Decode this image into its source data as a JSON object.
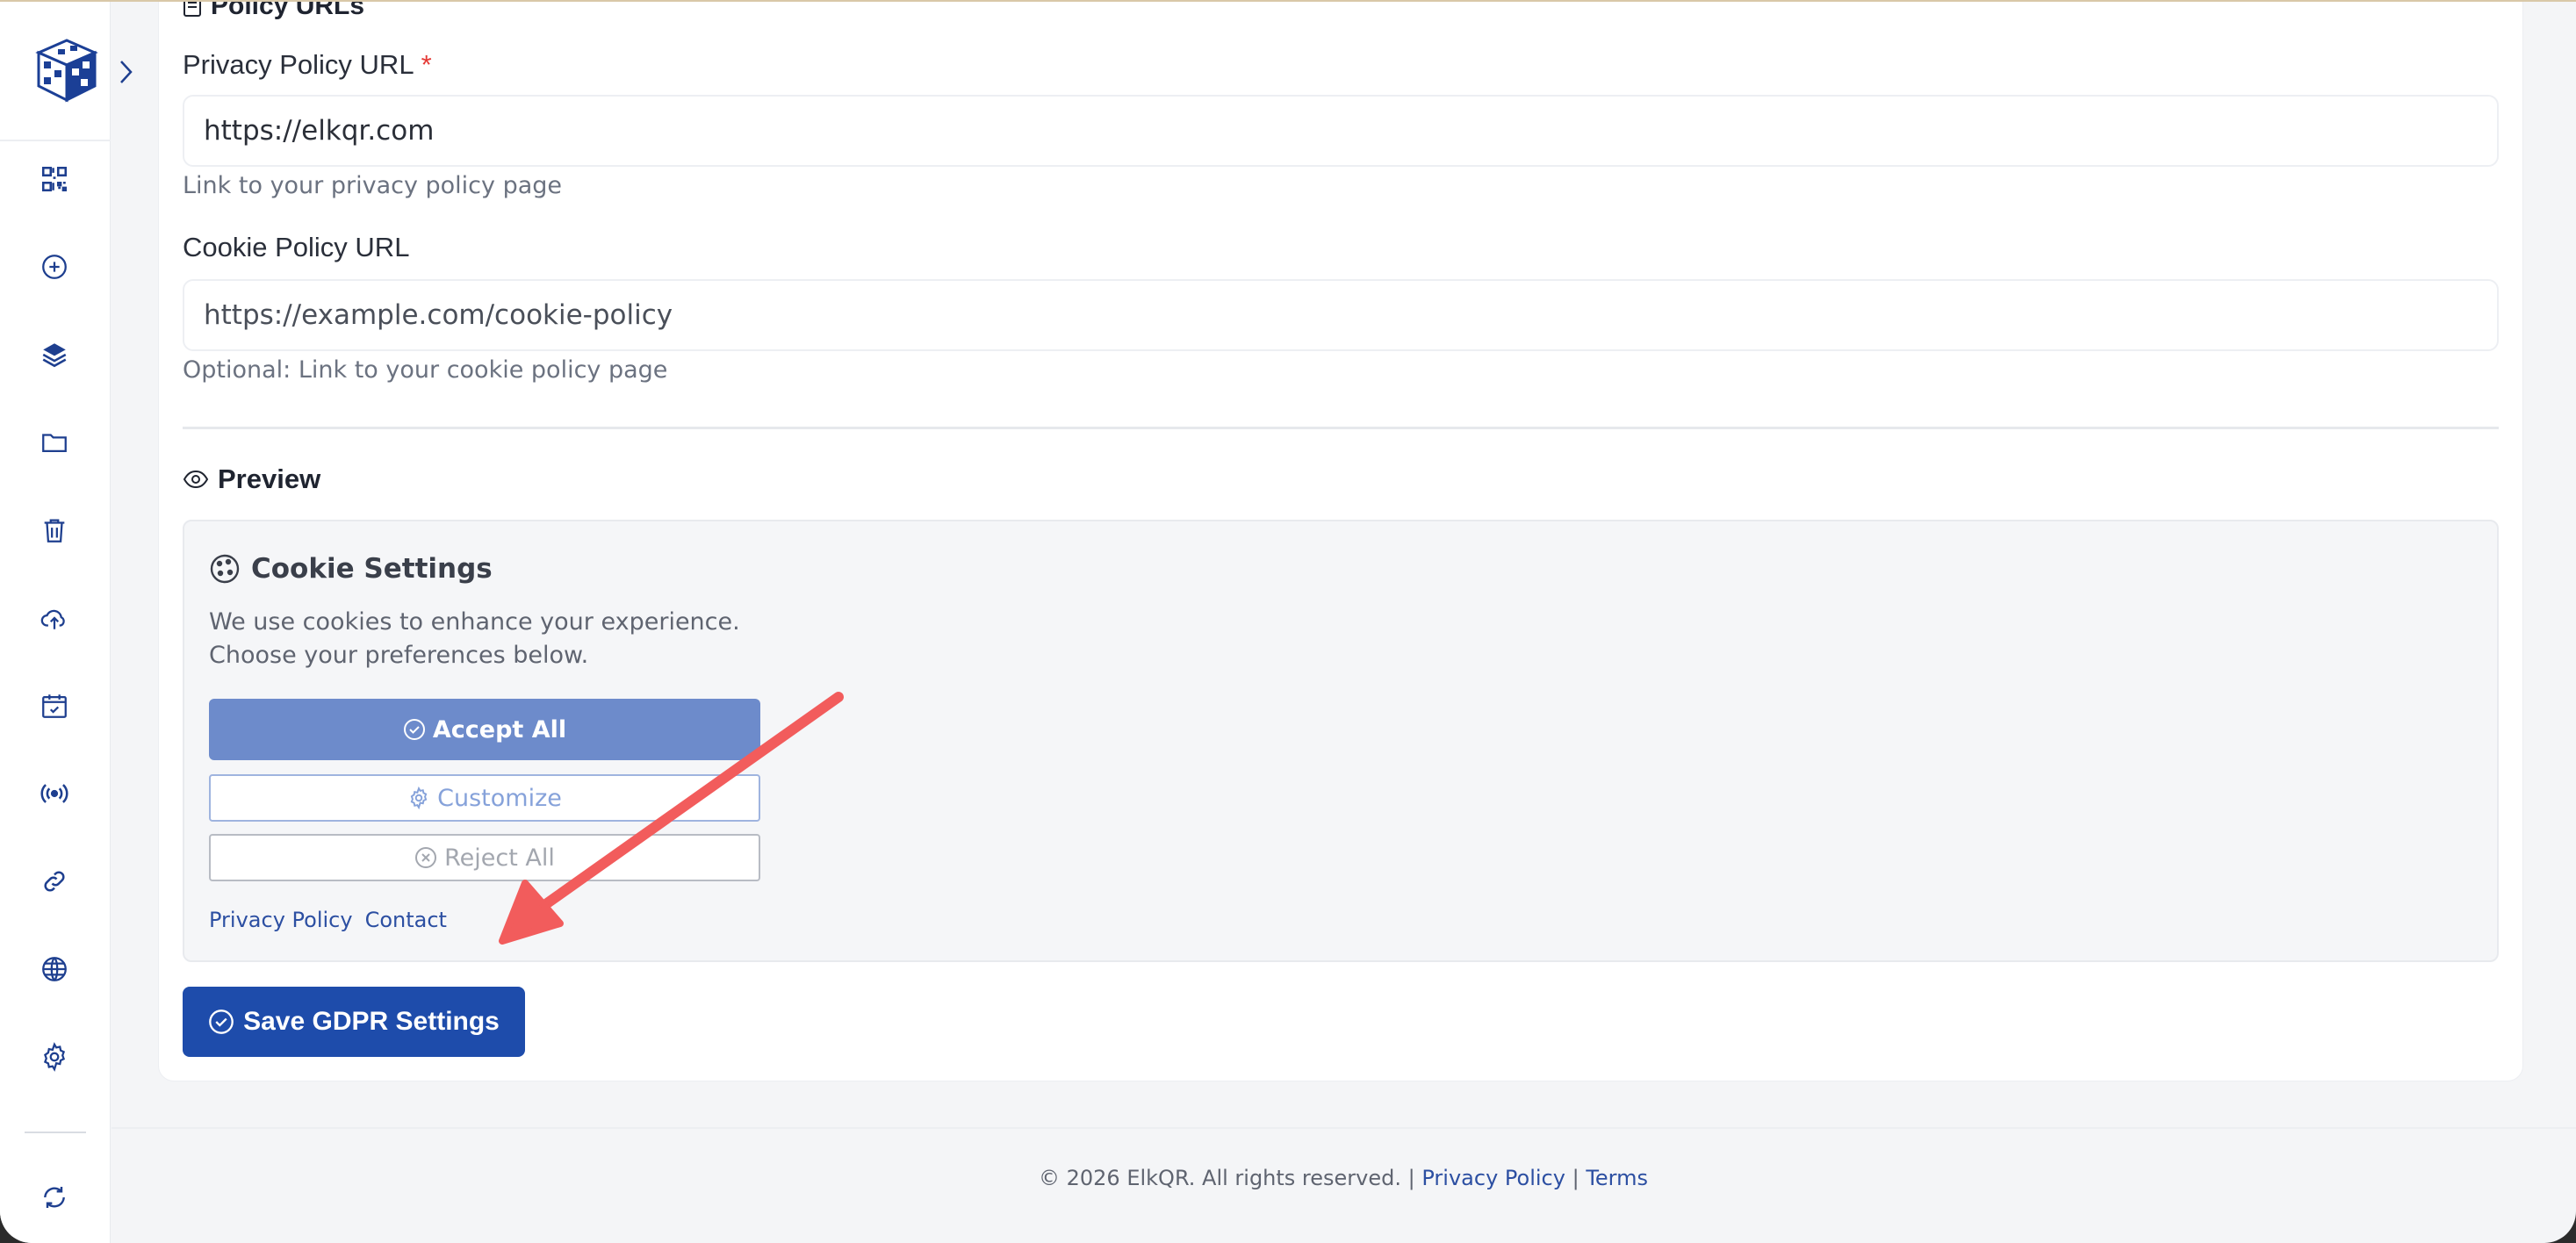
{
  "section": {
    "title": "Policy URLs"
  },
  "privacy_field": {
    "label": "Privacy Policy URL",
    "required_mark": "*",
    "value": "https://elkqr.com",
    "hint": "Link to your privacy policy page"
  },
  "cookie_field": {
    "label": "Cookie Policy URL",
    "placeholder": "https://example.com/cookie-policy",
    "hint": "Optional: Link to your cookie policy page"
  },
  "preview": {
    "title": "Preview",
    "cookie_title": "Cookie Settings",
    "desc_line1": "We use cookies to enhance your experience.",
    "desc_line2": "Choose your preferences below.",
    "accept_label": "Accept All",
    "customize_label": "Customize",
    "reject_label": "Reject All",
    "link_privacy": "Privacy Policy",
    "link_contact": "Contact"
  },
  "save_button": {
    "label": "Save GDPR Settings"
  },
  "footer": {
    "copyright": "© 2026 ElkQR. All rights reserved.",
    "sep": "|",
    "privacy": "Privacy Policy",
    "terms": "Terms"
  },
  "sidebar": {
    "items": [
      {
        "icon": "qr-code-icon"
      },
      {
        "icon": "plus-circle-icon"
      },
      {
        "icon": "layers-icon"
      },
      {
        "icon": "folder-icon"
      },
      {
        "icon": "trash-icon"
      },
      {
        "icon": "cloud-upload-icon"
      },
      {
        "icon": "calendar-check-icon"
      },
      {
        "icon": "broadcast-icon"
      },
      {
        "icon": "link-icon"
      },
      {
        "icon": "globe-icon"
      },
      {
        "icon": "gear-icon"
      },
      {
        "icon": "refresh-icon"
      }
    ]
  },
  "colors": {
    "primary": "#1e4cab",
    "accent_link": "#2c4fa2",
    "required": "#e53935",
    "annotation_arrow": "#f25c5c"
  }
}
